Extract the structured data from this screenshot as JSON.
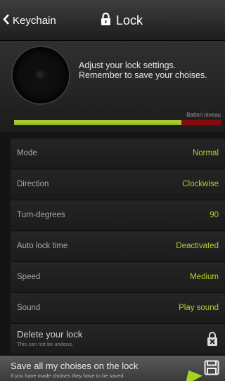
{
  "navbar": {
    "back_label": "Keychain",
    "title": "Lock"
  },
  "header": {
    "message": "Adjust your lock settings.\nRemember to save your choises.",
    "battery_label": "Batteri niveau",
    "battery_level": 0.81
  },
  "settings": [
    {
      "label": "Mode",
      "value": "Normal"
    },
    {
      "label": "Direction",
      "value": "Clockwise"
    },
    {
      "label": "Turn-degrees",
      "value": "90"
    },
    {
      "label": "Auto lock time",
      "value": "Deactivated"
    },
    {
      "label": "Speed",
      "value": "Medium"
    },
    {
      "label": "Sound",
      "value": "Play sound"
    }
  ],
  "delete": {
    "title": "Delete your lock",
    "subtitle": "This can not be undone."
  },
  "save": {
    "title": "Save all my choises on the lock",
    "subtitle": "If you have made choises they have to be saved."
  },
  "colors": {
    "accent": "#b0cf2a",
    "battery_fill": "#9cc525",
    "battery_empty": "#8a0a0a"
  },
  "icons": {
    "back": "chevron-left-icon",
    "title": "lock-icon",
    "delete": "lock-delete-icon",
    "save": "save-icon"
  }
}
